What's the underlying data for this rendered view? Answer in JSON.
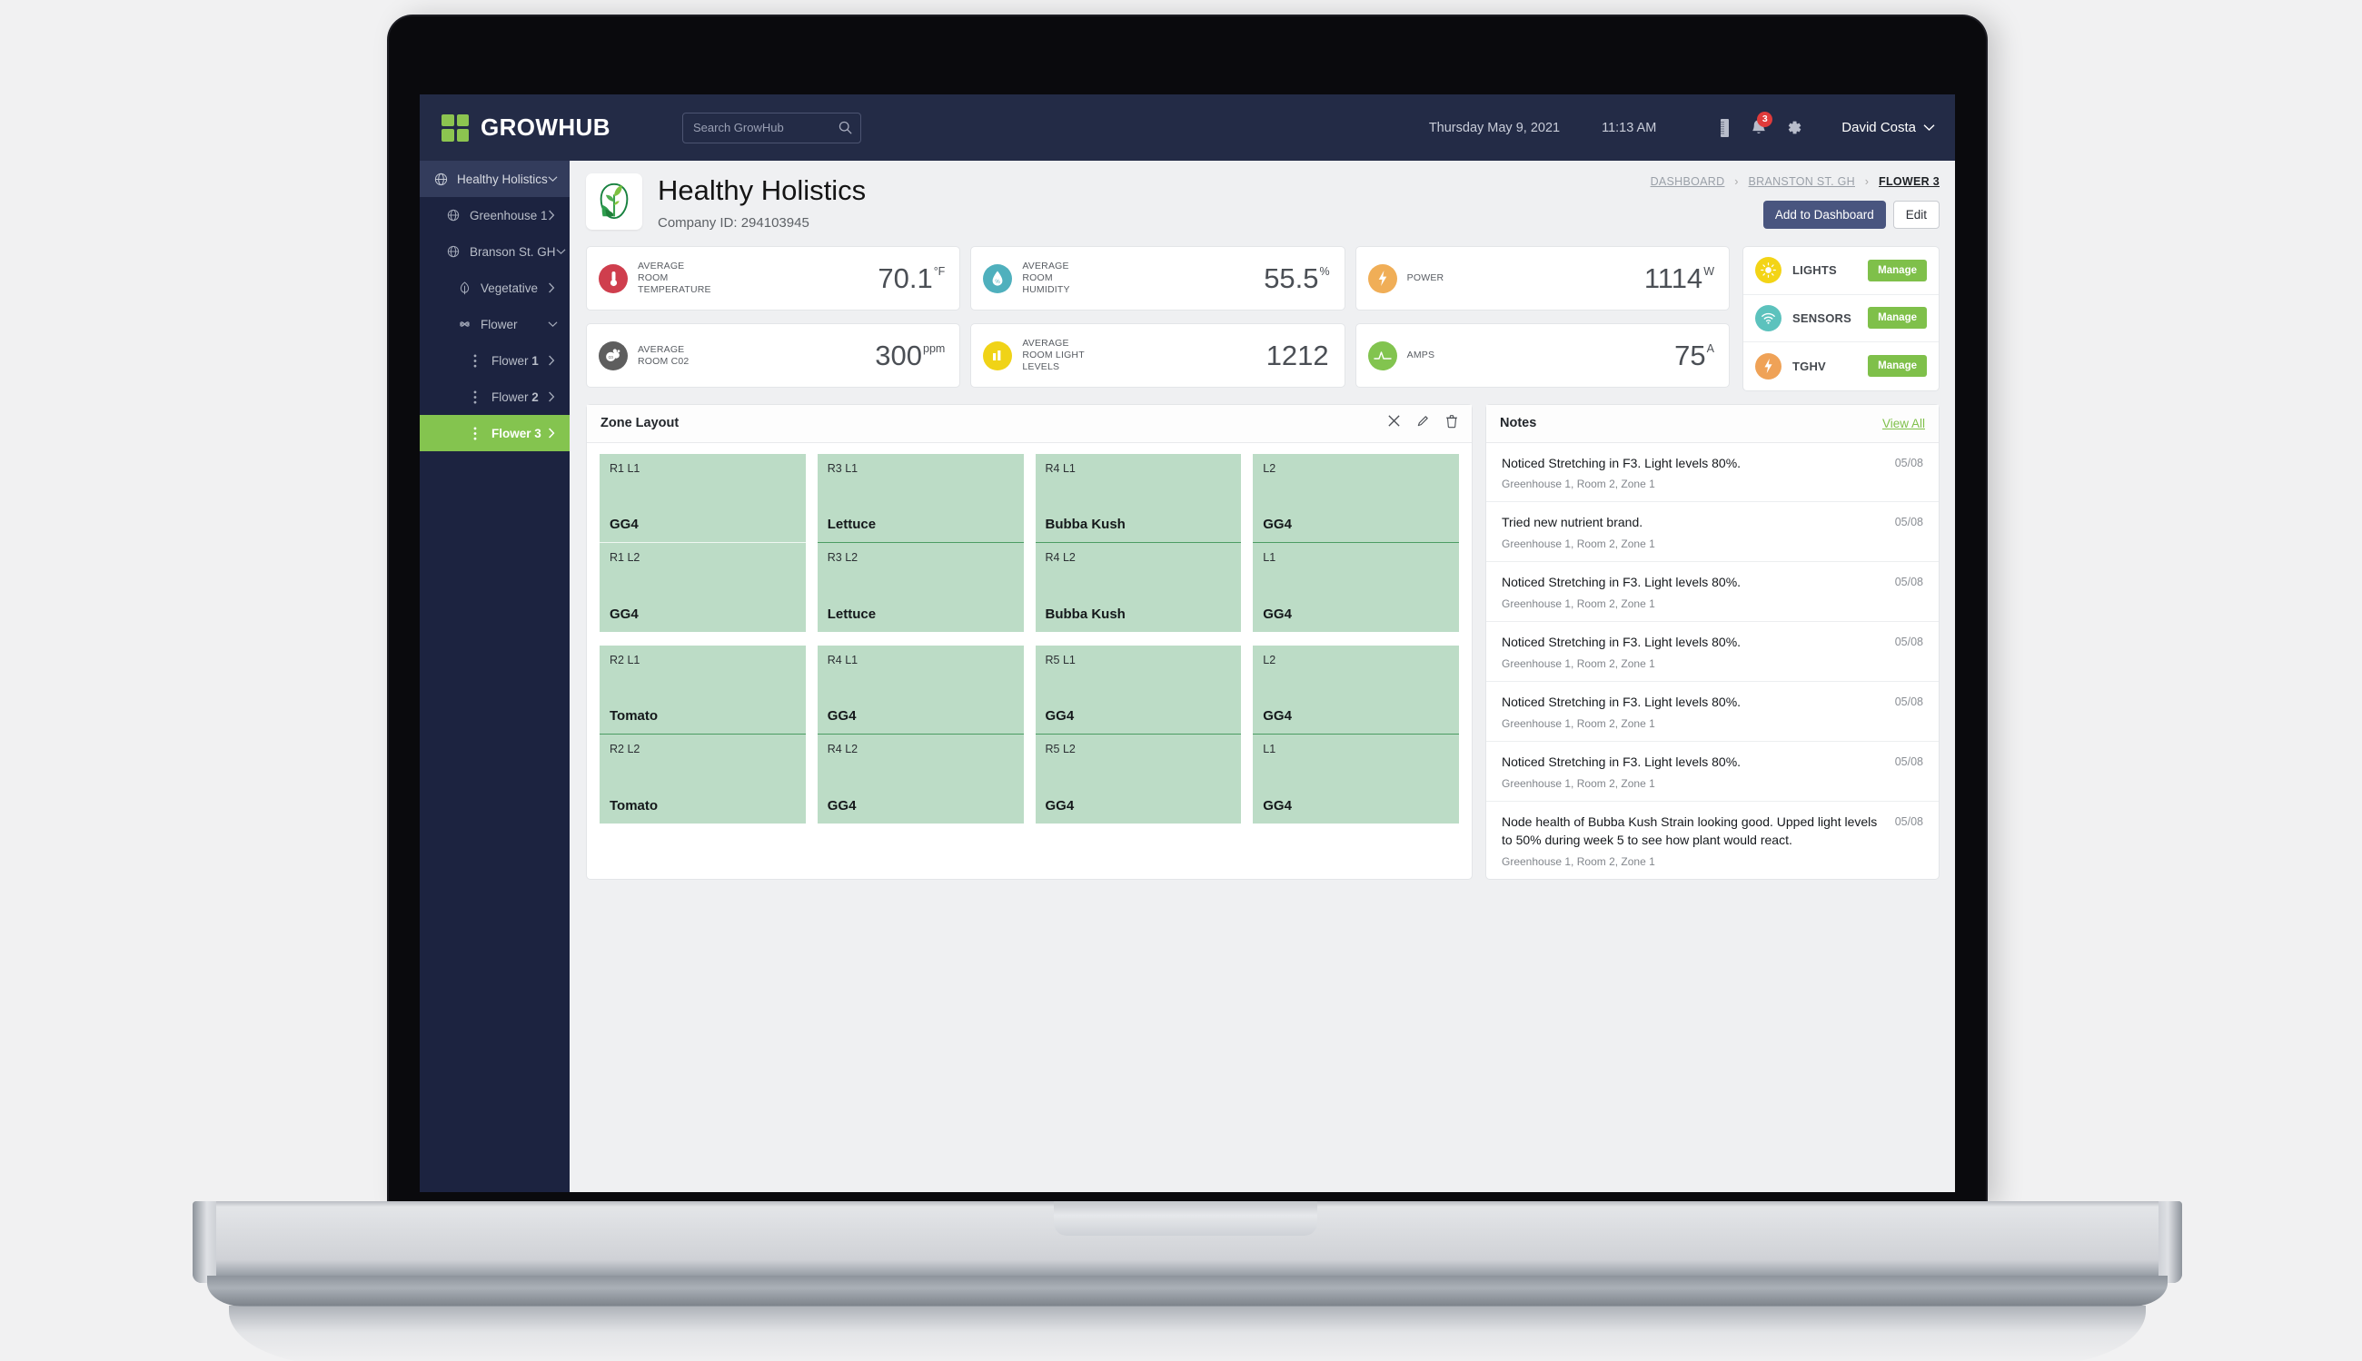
{
  "brand": {
    "name": "GROWHUB",
    "mark_color": "#8cc450"
  },
  "search": {
    "placeholder": "Search GrowHub",
    "value": "",
    "icon": "search-icon"
  },
  "topbar": {
    "date": "Thursday May 9, 2021",
    "time": "11:13 AM",
    "reports_icon": "reports-icon",
    "notifications_icon": "bell-icon",
    "notifications_count": "3",
    "settings_icon": "gear-icon",
    "user_name": "David Costa",
    "user_chevron": "chevron-down-icon"
  },
  "sidebar": {
    "items": [
      {
        "label": "Healthy Holistics",
        "icon": "globe-icon",
        "chevron": "chevron-down-icon",
        "level": 0,
        "active": false,
        "selected_header": true
      },
      {
        "label": "Greenhouse 1",
        "icon": "globe-icon",
        "chevron": "chevron-right-icon",
        "level": 1,
        "active": false
      },
      {
        "label": "Branson St. GH",
        "icon": "globe-icon",
        "chevron": "chevron-down-icon",
        "level": 1,
        "active": false
      },
      {
        "label": "Vegetative",
        "icon": "leaf-icon",
        "chevron": "chevron-right-icon",
        "level": 2,
        "active": false
      },
      {
        "label": "Flower",
        "icon": "flower-icon",
        "chevron": "chevron-down-icon",
        "level": 2,
        "active": false
      },
      {
        "label": "Flower 1",
        "label_plain": "Flower ",
        "label_bold": "1",
        "icon": "dots-vertical-icon",
        "chevron": "chevron-right-icon",
        "level": 3,
        "active": false
      },
      {
        "label": "Flower 2",
        "label_plain": "Flower ",
        "label_bold": "2",
        "icon": "dots-vertical-icon",
        "chevron": "chevron-right-icon",
        "level": 3,
        "active": false
      },
      {
        "label": "Flower 3",
        "label_plain": "Flower ",
        "label_bold": "3",
        "icon": "dots-vertical-icon",
        "chevron": "chevron-right-icon",
        "level": 3,
        "active": true
      }
    ],
    "active_color": "#84c44f"
  },
  "page": {
    "logo_icon": "plant-leaf-logo",
    "title": "Healthy Holistics",
    "company_id": "Company ID: 294103945",
    "breadcrumbs": [
      {
        "label": "DASHBOARD",
        "current": false
      },
      {
        "label": "BRANSTON ST. GH",
        "current": false
      },
      {
        "label": "FLOWER 3",
        "current": true
      }
    ],
    "breadcrumb_separator": "›",
    "add_to_dashboard_label": "Add to Dashboard",
    "edit_label": "Edit"
  },
  "metrics": [
    {
      "label": "AVERAGE ROOM TEMPERATURE",
      "value": "70.1",
      "unit": "°F",
      "icon": "thermometer-icon",
      "color": "#cf3e4d"
    },
    {
      "label": "AVERAGE ROOM HUMIDITY",
      "value": "55.5",
      "unit": "%",
      "icon": "humidity-drop-icon",
      "color": "#4fb0bd"
    },
    {
      "label": "POWER",
      "value": "1114",
      "unit": "W",
      "icon": "bolt-icon",
      "color": "#f0ae57"
    },
    {
      "label": "AVERAGE ROOM C02",
      "value": "300",
      "unit": "ppm",
      "icon": "co2-cloud-icon",
      "color": "#5e5e5e"
    },
    {
      "label": "AVERAGE ROOM LIGHT LEVELS",
      "value": "1212",
      "unit": "",
      "icon": "bar-chart-icon",
      "color": "#f0d317"
    },
    {
      "label": "AMPS",
      "value": "75",
      "unit": "A",
      "icon": "waveform-icon",
      "color": "#82c44f"
    }
  ],
  "rail": {
    "rows": [
      {
        "label": "LIGHTS",
        "button": "Manage",
        "icon": "sun-icon",
        "color": "#f3d416"
      },
      {
        "label": "SENSORS",
        "button": "Manage",
        "icon": "wifi-icon",
        "color": "#5cc2bd"
      },
      {
        "label": "TGHV",
        "button": "Manage",
        "icon": "bolt-icon",
        "color": "#efa257"
      }
    ],
    "button_color": "#7fc04a"
  },
  "zone_panel": {
    "title": "Zone Layout",
    "tools": [
      {
        "name": "close-icon",
        "glyph": "×"
      },
      {
        "name": "edit-pencil-icon",
        "glyph": "✎"
      },
      {
        "name": "delete-trash-icon",
        "glyph": "Ὕ1"
      }
    ],
    "rows": [
      {
        "columns": [
          {
            "top": {
              "code": "R1 L1",
              "name": "GG4"
            },
            "bottom": {
              "code": "R1 L2",
              "name": "GG4"
            },
            "divider": false
          },
          {
            "top": {
              "code": "R3 L1",
              "name": "Lettuce"
            },
            "bottom": {
              "code": "R3 L2",
              "name": "Lettuce"
            },
            "divider": true
          },
          {
            "top": {
              "code": "R4 L1",
              "name": "Bubba Kush"
            },
            "bottom": {
              "code": "R4 L2",
              "name": "Bubba Kush"
            },
            "divider": true
          },
          {
            "top": {
              "code": "L2",
              "name": "GG4"
            },
            "bottom": {
              "code": "L1",
              "name": "GG4"
            },
            "divider": true
          }
        ]
      },
      {
        "columns": [
          {
            "top": {
              "code": "R2 L1",
              "name": "Tomato"
            },
            "bottom": {
              "code": "R2 L2",
              "name": "Tomato"
            },
            "divider": true
          },
          {
            "top": {
              "code": "R4 L1",
              "name": "GG4"
            },
            "bottom": {
              "code": "R4 L2",
              "name": "GG4"
            },
            "divider": true
          },
          {
            "top": {
              "code": "R5 L1",
              "name": "GG4"
            },
            "bottom": {
              "code": "R5 L2",
              "name": "GG4"
            },
            "divider": true
          },
          {
            "top": {
              "code": "L2",
              "name": "GG4"
            },
            "bottom": {
              "code": "L1",
              "name": "GG4"
            },
            "divider": true
          }
        ]
      }
    ],
    "cell_color": "#bcdcc6"
  },
  "notes_panel": {
    "title": "Notes",
    "view_all": "View All",
    "notes": [
      {
        "text": "Noticed Stretching in F3. Light levels 80%.",
        "location": "Greenhouse 1, Room 2, Zone 1",
        "date": "05/08"
      },
      {
        "text": "Tried new nutrient brand.",
        "location": "Greenhouse 1, Room 2, Zone 1",
        "date": "05/08"
      },
      {
        "text": "Noticed Stretching in F3. Light levels 80%.",
        "location": "Greenhouse 1, Room 2, Zone 1",
        "date": "05/08"
      },
      {
        "text": "Noticed Stretching in F3. Light levels 80%.",
        "location": "Greenhouse 1, Room 2, Zone 1",
        "date": "05/08"
      },
      {
        "text": "Noticed Stretching in F3. Light levels 80%.",
        "location": "Greenhouse 1, Room 2, Zone 1",
        "date": "05/08"
      },
      {
        "text": "Noticed Stretching in F3. Light levels 80%.",
        "location": "Greenhouse 1, Room 2, Zone 1",
        "date": "05/08"
      },
      {
        "text": "Node health of Bubba Kush Strain looking good. Upped light levels to 50% during week 5 to see how plant would react.",
        "location": "Greenhouse 1, Room 2, Zone 1",
        "date": "05/08"
      }
    ]
  }
}
